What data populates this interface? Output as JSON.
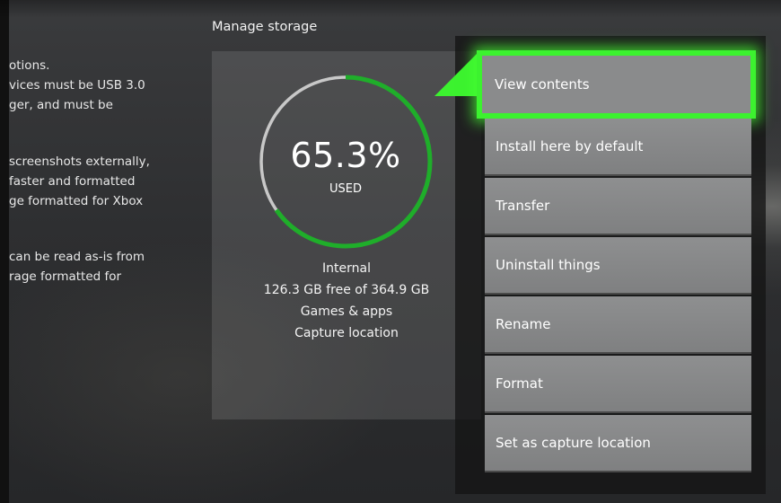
{
  "section_title": "Manage storage",
  "info_text": [
    "otions.",
    "vices must be USB 3.0",
    "ger, and must be",
    "screenshots externally,",
    "faster and formatted",
    "ge formatted for Xbox",
    "can be read as-is from",
    "rage formatted for"
  ],
  "storage": {
    "percent_used": "65.3%",
    "used_fraction": 0.653,
    "used_label": "USED",
    "drive_name": "Internal",
    "free_text": "126.3 GB free of 364.9 GB",
    "role_1": "Games & apps",
    "role_2": "Capture location"
  },
  "menu": {
    "items": [
      {
        "label": "View contents"
      },
      {
        "label": "Install here by default"
      },
      {
        "label": "Transfer"
      },
      {
        "label": "Uninstall things"
      },
      {
        "label": "Rename"
      },
      {
        "label": "Format"
      },
      {
        "label": "Set as capture location"
      }
    ],
    "focused_index": 0
  },
  "colors": {
    "accent_green": "#3cf22f",
    "gauge_used": "#1fae2a",
    "gauge_free": "#c8c8c8"
  }
}
